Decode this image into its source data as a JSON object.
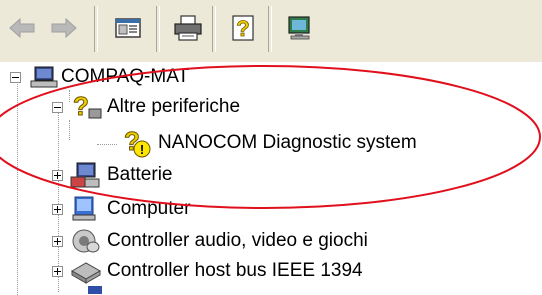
{
  "toolbar": {
    "buttons": [
      {
        "icon": "back-arrow-icon"
      },
      {
        "icon": "forward-arrow-icon"
      },
      {
        "icon": "properties-icon"
      },
      {
        "icon": "printer-icon"
      },
      {
        "icon": "help-icon"
      },
      {
        "icon": "scan-hardware-icon"
      }
    ]
  },
  "tree": {
    "root": {
      "label": "COMPAQ-MAT",
      "icon": "computer-icon"
    },
    "items": [
      {
        "label": "Altre periferiche",
        "expander": "minus",
        "icon": "unknown-device-icon"
      },
      {
        "label": "NANOCOM Diagnostic system",
        "icon": "warning-device-icon"
      },
      {
        "label": "Batterie",
        "expander": "plus",
        "icon": "battery-icon"
      },
      {
        "label": "Computer",
        "expander": "plus",
        "icon": "computer-icon"
      },
      {
        "label": "Controller audio, video e giochi",
        "expander": "plus",
        "icon": "audio-icon"
      },
      {
        "label": "Controller host bus IEEE 1394",
        "expander": "plus",
        "icon": "ieee1394-icon"
      }
    ]
  },
  "colors": {
    "toolbar_bg": "#ece9d8",
    "annotation_ellipse": "#e0101c"
  }
}
